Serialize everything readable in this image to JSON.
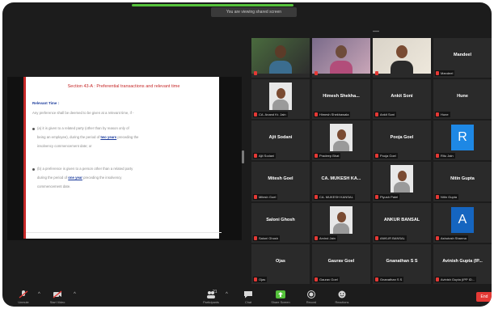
{
  "window": {
    "share_banner": "You are viewing shared screen",
    "collapse": "—"
  },
  "slide": {
    "title": "Section 43-A : Preferential transactions and relevant time",
    "subtitle": "Relevant Time :",
    "intro": "Any preference shall be deemed to be given at a relevant time, if -",
    "bullets": [
      [
        "(a) it is given to a related party (other than by reason only of",
        "being an employee), during the period of ",
        "two years",
        " preceding the",
        "insolvency commencement date; or"
      ],
      [
        "(b) a preference is given to a person other than a related party",
        "during the period of ",
        "one year",
        " preceding the insolvency",
        "commencement date."
      ]
    ]
  },
  "gallery": {
    "tiles": [
      {
        "id": "t1",
        "label": "",
        "type": "video"
      },
      {
        "id": "t2",
        "label": "",
        "type": "video"
      },
      {
        "id": "t3",
        "label": "",
        "type": "video"
      },
      {
        "id": "t4",
        "name": "Mandeel",
        "label": "Mandeel",
        "type": "name"
      },
      {
        "id": "t5",
        "label": "CA. Anand Kr. Jain",
        "type": "photo"
      },
      {
        "id": "t6",
        "name": "Himesh Shekha...",
        "label": "Himesh Shekhawala",
        "type": "name"
      },
      {
        "id": "t7",
        "name": "Ankit Soni",
        "label": "Ankit Soni",
        "type": "name"
      },
      {
        "id": "t8",
        "name": "Hune",
        "label": "Hune",
        "type": "name"
      },
      {
        "id": "t9",
        "name": "Ajit Sodani",
        "label": "Ajit Sodani",
        "type": "name"
      },
      {
        "id": "t10",
        "label": "Pradeep Bhat",
        "type": "photo"
      },
      {
        "id": "t11",
        "name": "Pooja Goel",
        "label": "Pooja Goel",
        "type": "name"
      },
      {
        "id": "t12",
        "label": "Ritu Jain",
        "type": "avatar",
        "letter": "R",
        "color": "#1e88e5"
      },
      {
        "id": "t13",
        "name": "Mitesh Goel",
        "label": "Mitesh Goel",
        "type": "name"
      },
      {
        "id": "t14",
        "name": "CA. MUKESH KA...",
        "label": "CA. MUKESH KANSAL",
        "type": "name"
      },
      {
        "id": "t15",
        "label": "Piyush Patel",
        "type": "photo"
      },
      {
        "id": "t16",
        "name": "Nitin Gupta",
        "label": "Nitin Gupta",
        "type": "name"
      },
      {
        "id": "t17",
        "name": "Saloni Ghosh",
        "label": "Saloni Ghosh",
        "type": "name"
      },
      {
        "id": "t18",
        "label": "Arvind Jain",
        "type": "photo"
      },
      {
        "id": "t19",
        "name": "ANKUR BANSAL",
        "label": "ANKUR BANSAL",
        "type": "name"
      },
      {
        "id": "t20",
        "label": "Ashutosh Sharma",
        "type": "avatar",
        "letter": "A",
        "color": "#1565c0"
      },
      {
        "id": "t21",
        "name": "Ojas",
        "label": "Ojas",
        "type": "name"
      },
      {
        "id": "t22",
        "name": "Gaurav Goel",
        "label": "Gaurav Goel",
        "type": "name"
      },
      {
        "id": "t23",
        "name": "Gnanathan S S",
        "label": "Gnanathan S S",
        "type": "name"
      },
      {
        "id": "t24",
        "name": "Avinish Gupta (IP...",
        "label": "Avinish Gupta (IPP ID...",
        "type": "name"
      }
    ]
  },
  "toolbar": {
    "unmute": "Unmute",
    "start_video": "Start Video",
    "participants_count": "21",
    "participants": "Participants",
    "chat": "Chat",
    "share_screen": "Share Screen",
    "record": "Record",
    "reactions": "Reactions",
    "end": "End",
    "colors": {
      "accent": "#55c23b",
      "danger": "#e53935"
    }
  }
}
